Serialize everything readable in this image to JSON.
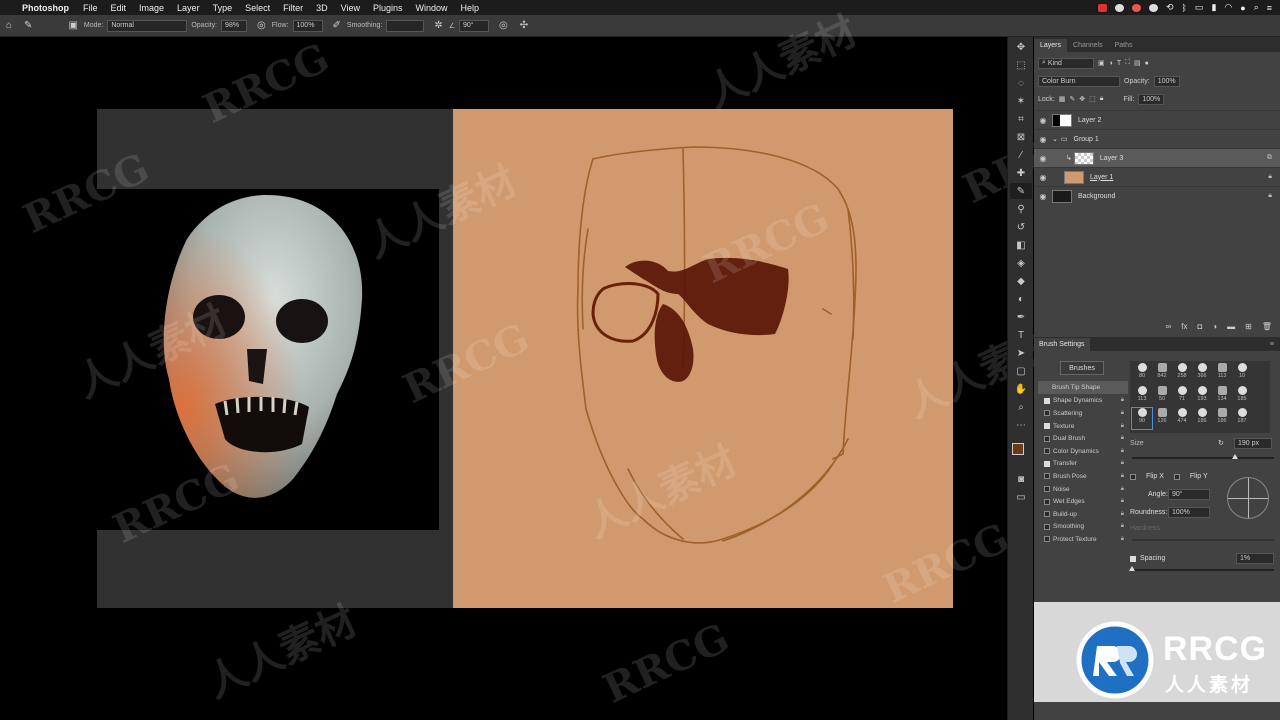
{
  "menubar": {
    "app_name": "Photoshop",
    "items": [
      "File",
      "Edit",
      "Image",
      "Layer",
      "Type",
      "Select",
      "Filter",
      "3D",
      "View",
      "Plugins",
      "Window",
      "Help"
    ]
  },
  "options_bar": {
    "mode_label": "Mode:",
    "mode_value": "Normal",
    "opacity_label": "Opacity:",
    "opacity_value": "98%",
    "flow_label": "Flow:",
    "flow_value": "100%",
    "smoothing_label": "Smoothing:",
    "angle_value": "90°"
  },
  "layers_panel": {
    "tabs": [
      "Layers",
      "Channels",
      "Paths"
    ],
    "filter_kind": "Kind",
    "blend_mode": "Color Burn",
    "opacity_label": "Opacity:",
    "opacity_value": "100%",
    "lock_label": "Lock:",
    "fill_label": "Fill:",
    "fill_value": "100%",
    "layers": [
      {
        "name": "Layer 2"
      },
      {
        "name": "Group 1"
      },
      {
        "name": "Layer 3"
      },
      {
        "name": "Layer 1"
      },
      {
        "name": "Background"
      }
    ]
  },
  "brush_settings": {
    "title": "Brush Settings",
    "brushes_button": "Brushes",
    "tip_shape": "Brush Tip Shape",
    "options": [
      {
        "label": "Shape Dynamics",
        "checked": true
      },
      {
        "label": "Scattering",
        "checked": false
      },
      {
        "label": "Texture",
        "checked": true
      },
      {
        "label": "Dual Brush",
        "checked": false
      },
      {
        "label": "Color Dynamics",
        "checked": false
      },
      {
        "label": "Transfer",
        "checked": true
      },
      {
        "label": "Brush Pose",
        "checked": false
      },
      {
        "label": "Noise",
        "checked": false
      },
      {
        "label": "Wet Edges",
        "checked": false
      },
      {
        "label": "Build-up",
        "checked": false
      },
      {
        "label": "Smoothing",
        "checked": false
      },
      {
        "label": "Protect Texture",
        "checked": false
      }
    ],
    "brush_sizes": [
      "80",
      "842",
      "258",
      "366",
      "113",
      "10",
      "113",
      "50",
      "71",
      "193",
      "134",
      "185",
      "90",
      "126",
      "474",
      "186",
      "186",
      "187"
    ],
    "size_label": "Size",
    "size_value": "190 px",
    "flip_x": "Flip X",
    "flip_y": "Flip Y",
    "angle_label": "Angle:",
    "angle_value": "90°",
    "roundness_label": "Roundness:",
    "roundness_value": "100%",
    "hardness_label": "Hardness",
    "spacing_label": "Spacing",
    "spacing_value": "1%"
  },
  "watermarks": {
    "latin": "RRCG",
    "cjk": "人人素材"
  },
  "logo": {
    "brand": "RRCG",
    "subtitle": "人人素材"
  },
  "colors": {
    "parchment": "#d09a6e",
    "foreground_swatch": "#6b3a16",
    "sketch_line": "#9b5a22",
    "paint": "#5a1606"
  }
}
